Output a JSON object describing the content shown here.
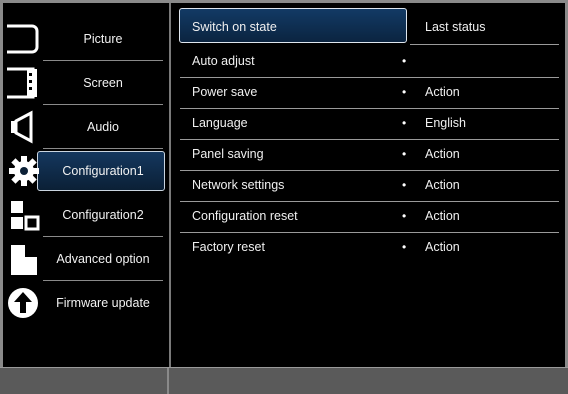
{
  "sidebar": {
    "items": [
      {
        "label": "Picture",
        "icon": "picture-icon"
      },
      {
        "label": "Screen",
        "icon": "screen-icon"
      },
      {
        "label": "Audio",
        "icon": "audio-icon"
      },
      {
        "label": "Configuration1",
        "icon": "gear-icon",
        "active": true
      },
      {
        "label": "Configuration2",
        "icon": "config2-icon"
      },
      {
        "label": "Advanced option",
        "icon": "advanced-icon"
      },
      {
        "label": "Firmware update",
        "icon": "firmware-update-icon"
      }
    ]
  },
  "menu": {
    "rows": [
      {
        "name": "Switch on state",
        "bullet": "",
        "value": "Last status"
      },
      {
        "name": "Auto adjust",
        "bullet": "•",
        "value": ""
      },
      {
        "name": "Power save",
        "bullet": "•",
        "value": "Action"
      },
      {
        "name": "Language",
        "bullet": "•",
        "value": "English"
      },
      {
        "name": "Panel saving",
        "bullet": "•",
        "value": "Action"
      },
      {
        "name": "Network settings",
        "bullet": "•",
        "value": "Action"
      },
      {
        "name": "Configuration reset",
        "bullet": "•",
        "value": "Action"
      },
      {
        "name": "Factory reset",
        "bullet": "•",
        "value": "Action"
      }
    ]
  },
  "colors": {
    "background": "#000000",
    "highlight": "#12365d",
    "separator": "#8a8a8a",
    "footer": "#5a5a5a"
  }
}
